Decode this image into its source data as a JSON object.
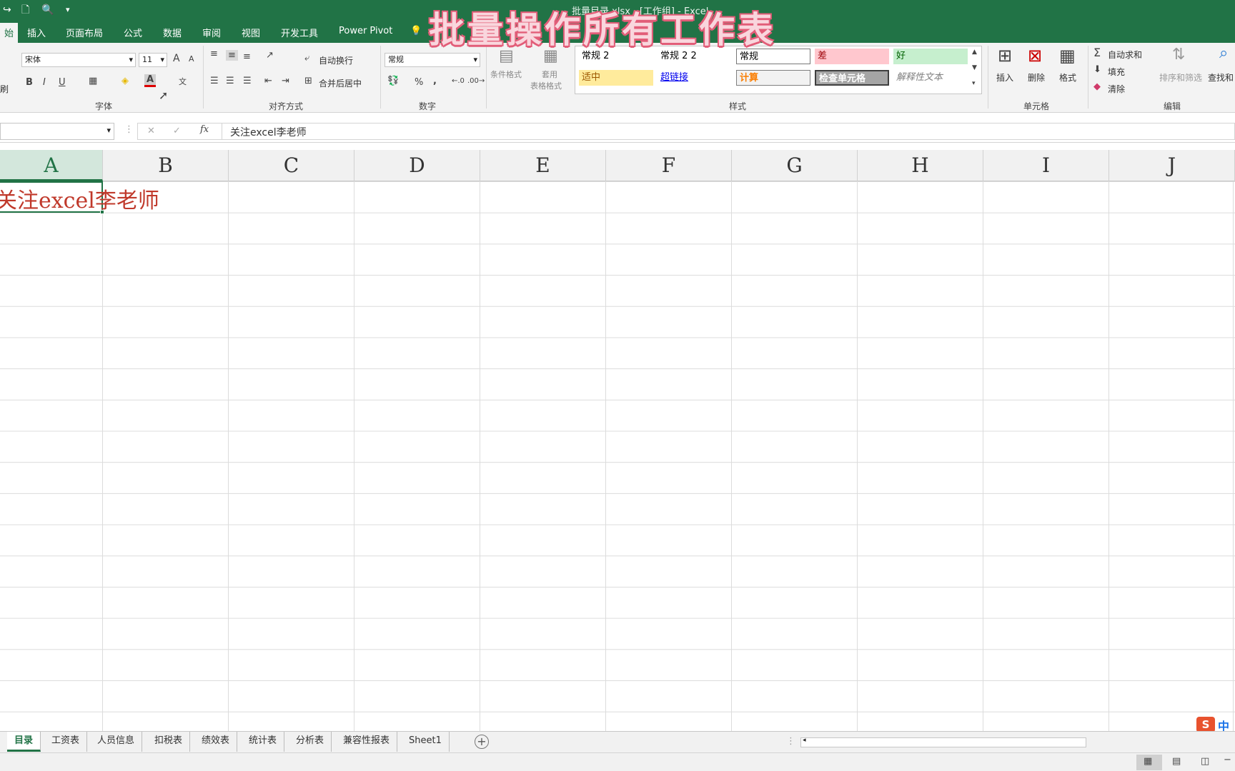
{
  "overlay_title": "批量操作所有工作表",
  "window": {
    "doc_title": "批量目录.xlsx - [工作组] - Excel"
  },
  "ribbon_tabs": [
    "始",
    "插入",
    "页面布局",
    "公式",
    "数据",
    "审阅",
    "视图",
    "开发工具",
    "Power Pivot",
    "告诉我您想要做什么"
  ],
  "font": {
    "name": "宋体",
    "size": "11",
    "bold": "B",
    "italic": "I",
    "underline": "U",
    "grow": "A",
    "shrink": "A"
  },
  "alignment": {
    "wrap": "自动换行",
    "merge": "合并后居中"
  },
  "number": {
    "format": "常规",
    "percent": "%",
    "comma": ","
  },
  "cond_format": {
    "conditional": "条件格式",
    "table_line1": "套用",
    "table_line2": "表格格式"
  },
  "styles": [
    {
      "label": "常规 2",
      "color": "#000000",
      "bg": "#ffffff"
    },
    {
      "label": "常规 2 2",
      "color": "#000000",
      "bg": "#ffffff"
    },
    {
      "label": "常规",
      "color": "#000000",
      "bg": "#ffffff"
    },
    {
      "label": "差",
      "color": "#9c0006",
      "bg": "#ffc7ce"
    },
    {
      "label": "好",
      "color": "#006100",
      "bg": "#c6efce"
    },
    {
      "label": "适中",
      "color": "#9c5700",
      "bg": "#ffeb9c"
    },
    {
      "label": "超链接",
      "color": "#0000ee",
      "bg": "#ffffff"
    },
    {
      "label": "计算",
      "color": "#fa7d00",
      "bg": "#f2f2f2"
    },
    {
      "label": "检查单元格",
      "color": "#ffffff",
      "bg": "#a5a5a5"
    },
    {
      "label": "解释性文本",
      "color": "#7f7f7f",
      "bg": "#ffffff"
    }
  ],
  "cells_group": {
    "insert": "插入",
    "delete": "删除",
    "format": "格式"
  },
  "editing": {
    "autosum": "自动求和",
    "fill": "填充",
    "clear": "清除",
    "sort": "排序和筛选",
    "find": "查找和"
  },
  "group_labels": {
    "font": "字体",
    "alignment": "对齐方式",
    "number": "数字",
    "styles": "样式",
    "cells": "单元格",
    "editing": "编辑",
    "edit_left": "刷"
  },
  "formula_bar": {
    "fx": "fx",
    "content": "关注excel李老师",
    "cancel": "✕",
    "confirm": "✓"
  },
  "columns": [
    "A",
    "B",
    "C",
    "D",
    "E",
    "F",
    "G",
    "H",
    "I",
    "J"
  ],
  "active_cell_text": "关注excel李老师",
  "sheets": [
    "目录",
    "工资表",
    "人员信息",
    "扣税表",
    "绩效表",
    "统计表",
    "分析表",
    "兼容性报表",
    "Sheet1"
  ],
  "ime": {
    "logo": "S",
    "mode": "中"
  }
}
